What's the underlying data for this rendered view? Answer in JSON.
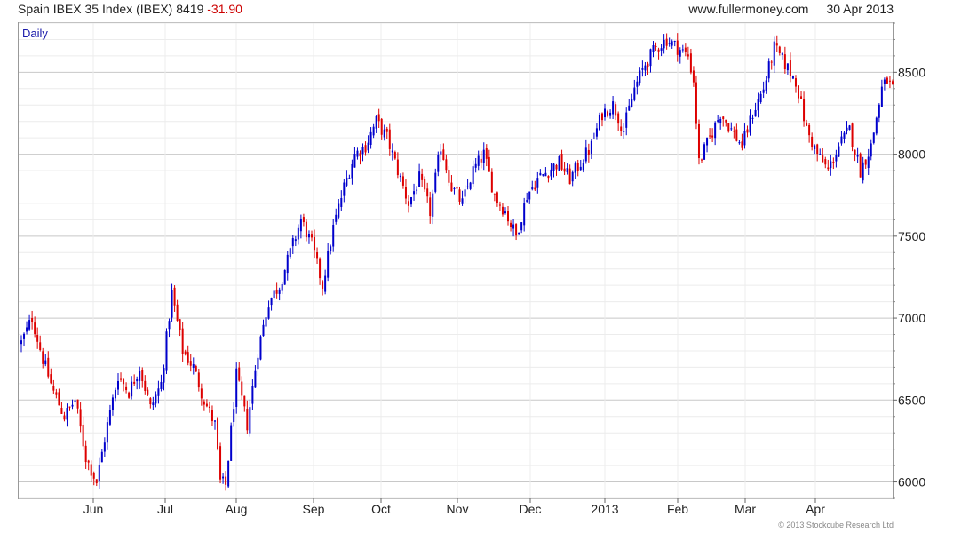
{
  "header": {
    "title": "Spain IBEX 35 Index (IBEX)",
    "last": "8419",
    "change": "-31.90",
    "site": "www.fullermoney.com",
    "date": "30 Apr 2013"
  },
  "chart_data": {
    "type": "candlestick",
    "period_label": "Daily",
    "ylim": [
      5900,
      8800
    ],
    "y_ticks": [
      6000,
      6500,
      7000,
      7500,
      8000,
      8500
    ],
    "y_tick_labels": [
      "6000",
      "6500",
      "7000",
      "7500",
      "8000",
      "8500"
    ],
    "x_tick_labels": [
      "Jun",
      "Jul",
      "Aug",
      "Sep",
      "Oct",
      "Nov",
      "Dec",
      "2013",
      "Feb",
      "Mar",
      "Apr"
    ],
    "grid": true,
    "up_color": "#0000cc",
    "down_color": "#dd0000",
    "close_path": [
      [
        0,
        6850
      ],
      [
        4,
        7000
      ],
      [
        8,
        6750
      ],
      [
        12,
        6550
      ],
      [
        16,
        6400
      ],
      [
        20,
        6500
      ],
      [
        24,
        6150
      ],
      [
        28,
        6000
      ],
      [
        32,
        6350
      ],
      [
        36,
        6650
      ],
      [
        40,
        6550
      ],
      [
        44,
        6700
      ],
      [
        48,
        6450
      ],
      [
        52,
        6600
      ],
      [
        56,
        7150
      ],
      [
        60,
        6800
      ],
      [
        64,
        6700
      ],
      [
        68,
        6500
      ],
      [
        72,
        6350
      ],
      [
        74,
        6000
      ],
      [
        76,
        5980
      ],
      [
        80,
        6650
      ],
      [
        84,
        6350
      ],
      [
        88,
        6800
      ],
      [
        92,
        7100
      ],
      [
        96,
        7200
      ],
      [
        100,
        7400
      ],
      [
        104,
        7600
      ],
      [
        108,
        7450
      ],
      [
        112,
        7200
      ],
      [
        116,
        7550
      ],
      [
        120,
        7800
      ],
      [
        124,
        8000
      ],
      [
        128,
        8050
      ],
      [
        132,
        8200
      ],
      [
        136,
        8100
      ],
      [
        140,
        7900
      ],
      [
        144,
        7700
      ],
      [
        148,
        7850
      ],
      [
        152,
        7650
      ],
      [
        156,
        8050
      ],
      [
        160,
        7800
      ],
      [
        164,
        7700
      ],
      [
        168,
        7900
      ],
      [
        172,
        8000
      ],
      [
        176,
        7750
      ],
      [
        180,
        7650
      ],
      [
        184,
        7500
      ],
      [
        188,
        7750
      ],
      [
        192,
        7850
      ],
      [
        196,
        7900
      ],
      [
        200,
        7950
      ],
      [
        204,
        7850
      ],
      [
        208,
        7950
      ],
      [
        212,
        8050
      ],
      [
        216,
        8250
      ],
      [
        220,
        8300
      ],
      [
        224,
        8150
      ],
      [
        228,
        8400
      ],
      [
        232,
        8550
      ],
      [
        236,
        8650
      ],
      [
        240,
        8700
      ],
      [
        244,
        8650
      ],
      [
        248,
        8600
      ],
      [
        250,
        8450
      ],
      [
        252,
        7950
      ],
      [
        256,
        8100
      ],
      [
        260,
        8250
      ],
      [
        264,
        8150
      ],
      [
        268,
        8050
      ],
      [
        272,
        8250
      ],
      [
        276,
        8400
      ],
      [
        280,
        8650
      ],
      [
        284,
        8550
      ],
      [
        288,
        8450
      ],
      [
        292,
        8150
      ],
      [
        296,
        8000
      ],
      [
        300,
        7900
      ],
      [
        304,
        8050
      ],
      [
        308,
        8150
      ],
      [
        312,
        7900
      ],
      [
        316,
        8050
      ],
      [
        320,
        8400
      ],
      [
        322,
        8450
      ],
      [
        324,
        8400
      ]
    ]
  }
}
